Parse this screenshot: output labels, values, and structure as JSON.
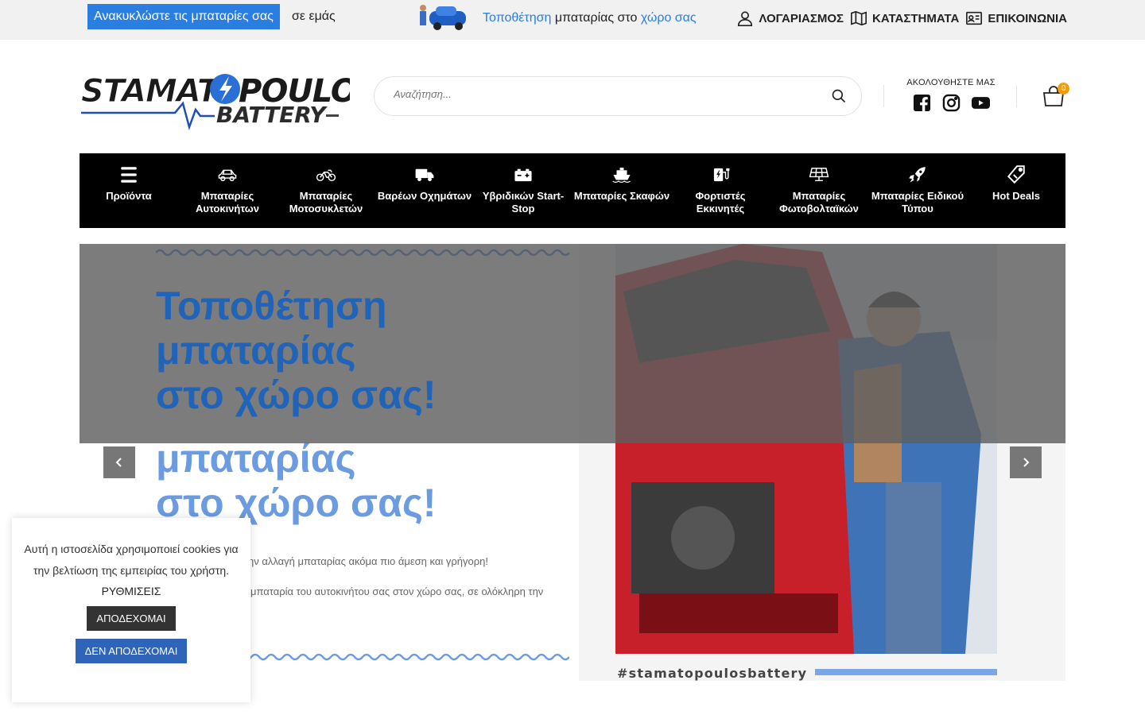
{
  "topbar": {
    "recycle_label": "Ανακυκλώστε τις μπαταρίες σας",
    "recycle_tail": "σε εμάς",
    "promo_part1": "Τοποθέτηση",
    "promo_part2": " μπαταρίας στο ",
    "promo_part3": "χώρο σας",
    "links": [
      {
        "label": "ΛΟΓΑΡΙΑΣΜΟΣ",
        "icon": "user-icon"
      },
      {
        "label": "ΚΑΤΑΣΤΗΜΑΤΑ",
        "icon": "map-icon"
      },
      {
        "label": "ΕΠΙΚΟΙΝΩΝΙΑ",
        "icon": "contact-card-icon"
      }
    ]
  },
  "header": {
    "logo_text": "STAMATOPOULOS BATTERY",
    "search_placeholder": "Αναζήτηση...",
    "follow_label": "ΑΚΟΛΟΥΘΗΣΤΕ ΜΑΣ",
    "socials": [
      "facebook-icon",
      "instagram-icon",
      "youtube-icon"
    ],
    "cart_count": "0"
  },
  "nav": {
    "items": [
      {
        "label": "Προϊόντα",
        "icon": "menu-icon"
      },
      {
        "label": "Μπαταρίες Αυτοκινήτων",
        "icon": "car-icon"
      },
      {
        "label": "Μπαταρίες Μοτοσυκλετών",
        "icon": "motorcycle-icon"
      },
      {
        "label": "Βαρέων Οχημάτων",
        "icon": "truck-icon"
      },
      {
        "label": "Υβριδικών Start-Stop",
        "icon": "battery-icon"
      },
      {
        "label": "Μπαταρίες Σκαφών",
        "icon": "ship-icon"
      },
      {
        "label": "Φορτιστές Εκκινητές",
        "icon": "charger-icon"
      },
      {
        "label": "Μπαταρίες Φωτοβολταϊκών",
        "icon": "solar-panel-icon"
      },
      {
        "label": "Μπαταρίες Ειδικού Τύπου",
        "icon": "rocket-icon"
      },
      {
        "label": "Hot Deals",
        "icon": "tag-icon"
      }
    ]
  },
  "slider": {
    "headline_line1": "Τοποθέτηση",
    "headline_line2": "μπαταρίας",
    "headline_line3": "στο χώρο σας!",
    "sub1": "ην αλλαγή μπαταρίας ακόμα πιο άμεση και γρήγορη!",
    "sub2": "μπαταρία του αυτοκινήτου σας στον χώρο σας, σε ολόκληρη την",
    "hashtag": "#stamatopoulosbattery"
  },
  "cookie": {
    "message": "Αυτή η ιστοσελίδα χρησιμοποιεί cookies για την βελτίωση της εμπειρίας του χρήστη.",
    "settings_label": "ΡΥΘΜΙΣΕΙΣ",
    "accept_label": "ΑΠΟΔΕΧΟΜΑΙ",
    "decline_label": "ΔΕΝ ΑΠΟΔΕΧΟΜΑΙ"
  },
  "colors": {
    "accent": "#2a7de1",
    "nav_bg": "#000000",
    "cart_badge": "#f39c12"
  }
}
